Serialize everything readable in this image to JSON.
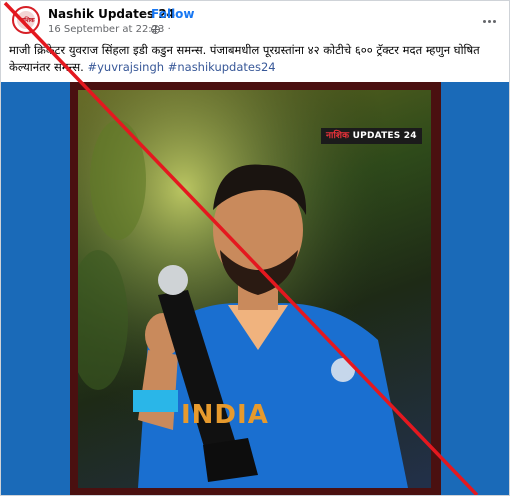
{
  "post": {
    "page_name": "Nashik Updates 24",
    "separator": "·",
    "follow_label": "Follow",
    "timestamp": "16 September at 22:23 ·",
    "avatar_text": "नाशिक",
    "more_icon": "more-options-icon",
    "text_line1": "माजी क्रिकेटर युवराज सिंहला इडी कडुन समन्स. पंजाबमधील पूरग्रस्तांना ४२ कोटीचे ६०० ट्रॅक्टर मदत म्हणुन घोषित",
    "text_line2": "केल्यानंतर समन्स.",
    "hashtags": [
      "#yuvrajsingh",
      "#nashikupdates24"
    ]
  },
  "image": {
    "watermark_part1": "नाशिक",
    "watermark_part2": "UPDATES 24",
    "jersey_text": "INDIA"
  },
  "colors": {
    "media_bg": "#1a6ab8",
    "frame": "#4a1010",
    "strike": "#e4181f",
    "link": "#1877f2"
  }
}
